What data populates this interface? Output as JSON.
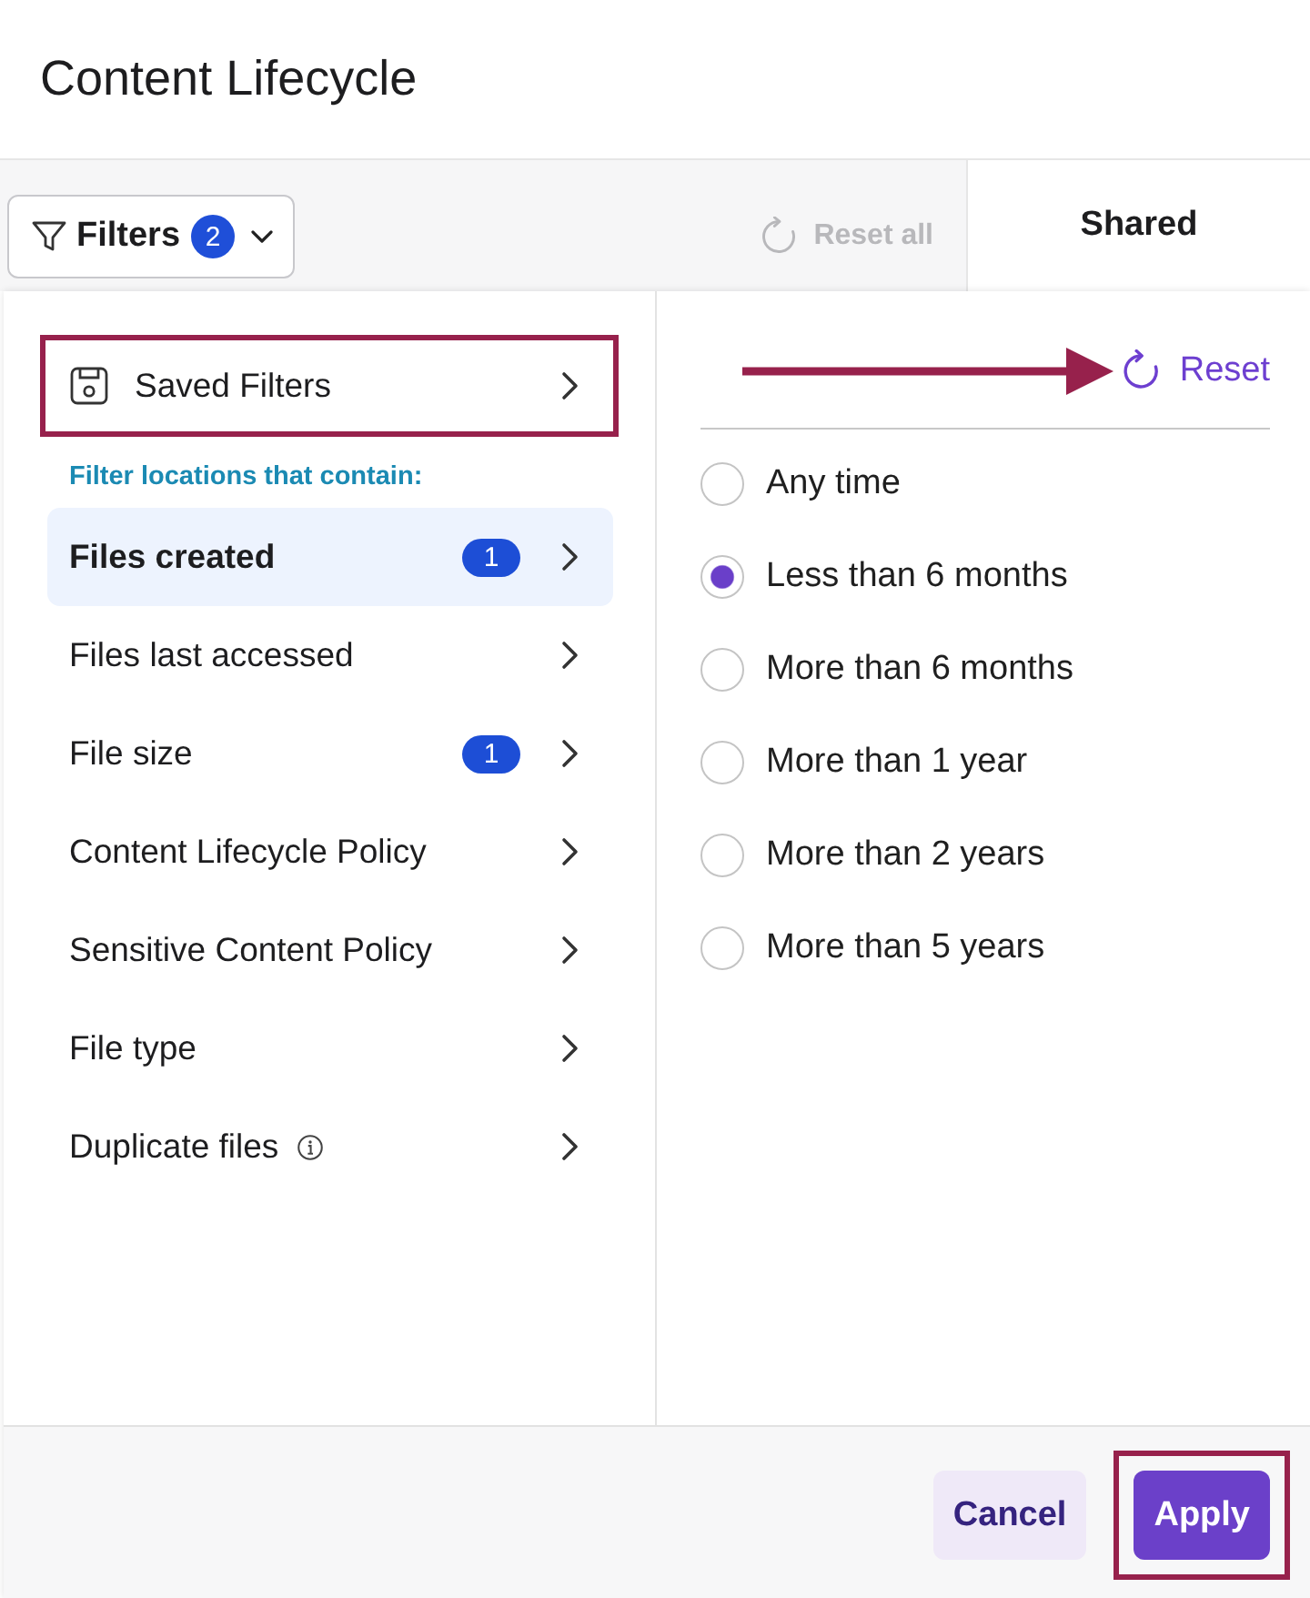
{
  "header": {
    "title": "Content Lifecycle"
  },
  "toolbar": {
    "filters_button": {
      "label": "Filters",
      "count": "2"
    },
    "reset_all": {
      "label": "Reset all",
      "disabled": true
    }
  },
  "shared_column": {
    "heading": "Shared"
  },
  "filter_panel": {
    "saved_filters": {
      "label": "Saved Filters",
      "highlighted": true
    },
    "section_heading": "Filter locations that contain:",
    "categories": [
      {
        "label": "Files created",
        "selected": true,
        "count": "1",
        "info": false
      },
      {
        "label": "Files last accessed",
        "selected": false,
        "info": false
      },
      {
        "label": "File size",
        "selected": false,
        "count": "1",
        "info": false
      },
      {
        "label": "Content Lifecycle Policy",
        "selected": false,
        "info": false
      },
      {
        "label": "Sensitive Content Policy",
        "selected": false,
        "info": false
      },
      {
        "label": "File type",
        "selected": false,
        "info": false
      },
      {
        "label": "Duplicate files",
        "selected": false,
        "info": true
      }
    ],
    "options_reset": {
      "label": "Reset",
      "arrow": true
    },
    "options": [
      {
        "label": "Any time",
        "selected": false
      },
      {
        "label": "Less than 6 months",
        "selected": true
      },
      {
        "label": "More than 6 months",
        "selected": false
      },
      {
        "label": "More than 1 year",
        "selected": false
      },
      {
        "label": "More than 2 years",
        "selected": false
      },
      {
        "label": "More than 5 years",
        "selected": false
      }
    ],
    "footer": {
      "buttons": [
        {
          "label": "Cancel",
          "kind": "secondary",
          "highlighted": false
        },
        {
          "label": "Apply",
          "kind": "primary",
          "highlighted": true
        }
      ]
    }
  }
}
